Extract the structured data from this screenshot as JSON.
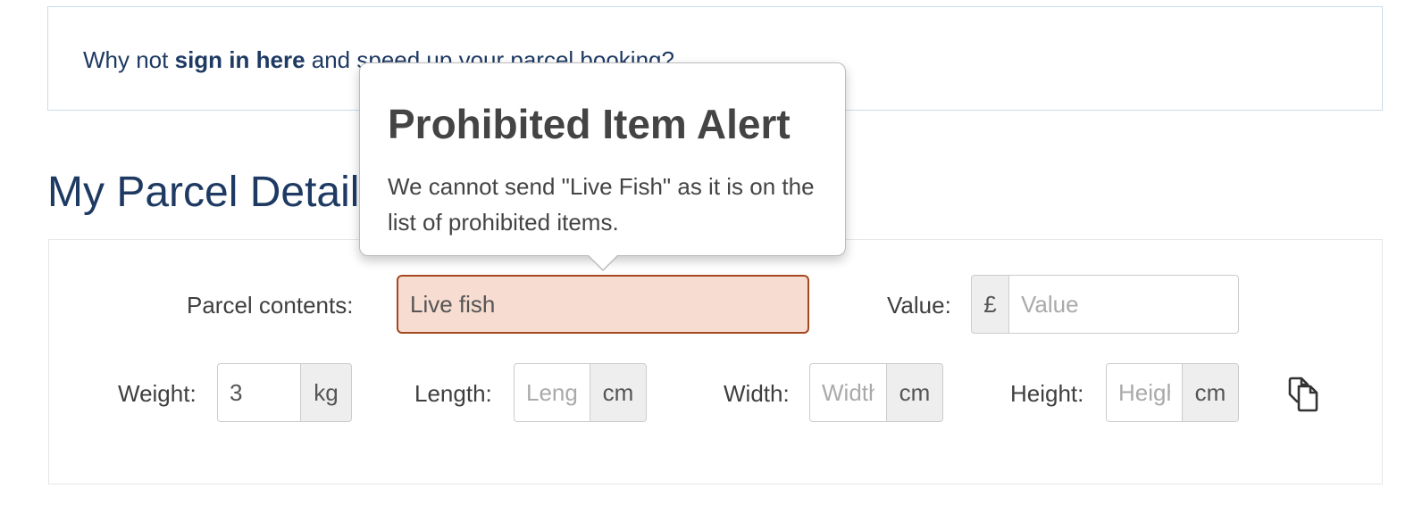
{
  "banner": {
    "prefix": "Why not",
    "link": "sign in here",
    "suffix": "and speed up your parcel booking?"
  },
  "section": {
    "title": "My Parcel Details"
  },
  "form": {
    "contents": {
      "label": "Parcel contents:",
      "value": "Live fish",
      "state": "error",
      "error_color": "#a4491f"
    },
    "value": {
      "label": "Value:",
      "currency": "£",
      "placeholder": "Value"
    },
    "weight": {
      "label": "Weight:",
      "value": "3",
      "unit": "kg"
    },
    "length": {
      "label": "Length:",
      "placeholder": "Length",
      "unit": "cm"
    },
    "width": {
      "label": "Width:",
      "placeholder": "Width",
      "unit": "cm"
    },
    "height": {
      "label": "Height:",
      "placeholder": "Height",
      "unit": "cm"
    },
    "copy_icon": "copy-icon"
  },
  "popover": {
    "title": "Prohibited Item Alert",
    "body": "We cannot send \"Live Fish\" as it is on the list of prohibited items."
  },
  "colors": {
    "brand_navy": "#1e3a63",
    "error_fill": "#f6dcd1",
    "banner_border": "#c9dcea"
  }
}
